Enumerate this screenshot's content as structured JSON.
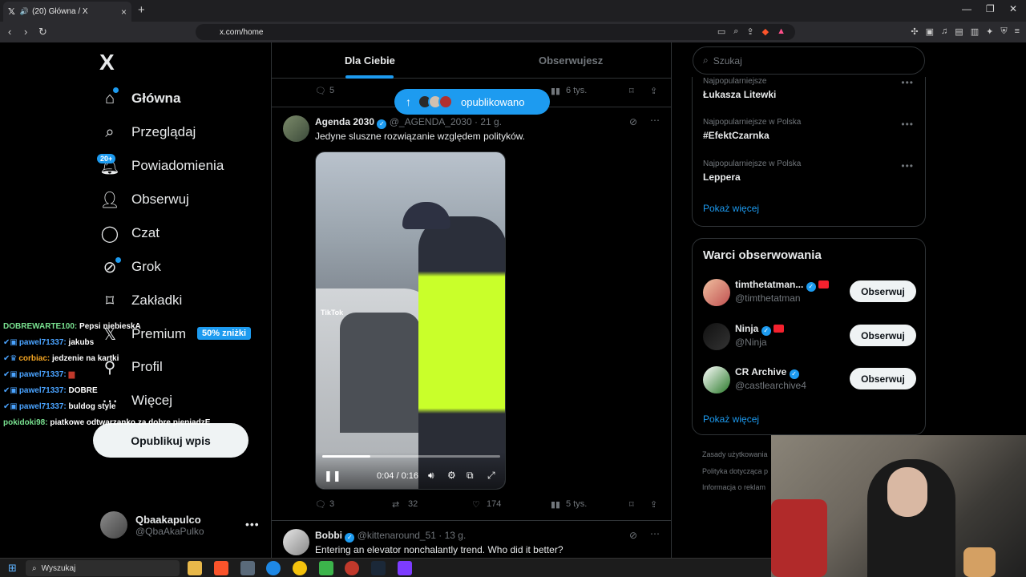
{
  "browser": {
    "tab_title": "(20) Główna / X",
    "url": "x.com/home"
  },
  "sidebar": {
    "logo": "X",
    "items": [
      {
        "label": "Główna"
      },
      {
        "label": "Przeglądaj"
      },
      {
        "label": "Powiadomienia",
        "badge": "20+"
      },
      {
        "label": "Obserwuj"
      },
      {
        "label": "Czat"
      },
      {
        "label": "Grok"
      },
      {
        "label": "Zakładki"
      },
      {
        "label": "Premium",
        "pill": "50% zniżki"
      },
      {
        "label": "Profil"
      },
      {
        "label": "Więcej"
      }
    ],
    "publish": "Opublikuj wpis",
    "profile": {
      "name": "Qbaakapulco",
      "handle": "@QbaAkaPulko"
    }
  },
  "chat": [
    {
      "user": "DOBREWARTE100:",
      "msg": "Pepsi niebieskA",
      "color": "green"
    },
    {
      "user": "pawel71337:",
      "msg": "jakubs",
      "color": "blue"
    },
    {
      "user": "corbiac:",
      "msg": "jedzenie na kartki",
      "color": "orange"
    },
    {
      "user": "pawel71337:",
      "msg": "",
      "color": "blue"
    },
    {
      "user": "pawel71337:",
      "msg": "DOBRE",
      "color": "blue"
    },
    {
      "user": "pawel71337:",
      "msg": "buldog style",
      "color": "blue"
    },
    {
      "user": "pokidoki98:",
      "msg": "piatkowe odtwarzanko za dobre pieniadzE",
      "color": "green"
    }
  ],
  "feed": {
    "tabs": [
      "Dla Ciebie",
      "Obserwujesz"
    ],
    "prev_post": {
      "replies": "5",
      "views": "6 tys."
    },
    "new_posts_pill": "opublikowano",
    "post": {
      "name": "Agenda 2030",
      "handle": "@_AGENDA_2030",
      "time": "· 21 g.",
      "text": "Jedyne sluszne rozwiązanie względem polityków.",
      "video_watermark": "TikTok",
      "video_time": "0:04 / 0:16",
      "video_progress": 0.27,
      "replies": "3",
      "reposts": "32",
      "likes": "174",
      "views": "5 tys."
    },
    "next_post": {
      "name": "Bobbi",
      "handle": "@kittenaround_51",
      "time": "· 13 g.",
      "text": "Entering an elevator nonchalantly trend. Who did it better?"
    }
  },
  "right": {
    "search_placeholder": "Szukaj",
    "trends": [
      {
        "category": "Najpopularniejsze",
        "name": "Łukasza Litewki"
      },
      {
        "category": "Najpopularniejsze w Polska",
        "name": "#EfektCzarnka"
      },
      {
        "category": "Najpopularniejsze w Polska",
        "name": "Leppera"
      }
    ],
    "show_more": "Pokaż więcej",
    "who_title": "Warci obserwowania",
    "accounts": [
      {
        "name": "timthetatman...",
        "handle": "@timthetatman"
      },
      {
        "name": "Ninja",
        "handle": "@Ninja"
      },
      {
        "name": "CR Archive",
        "handle": "@castlearchive4"
      }
    ],
    "follow_label": "Obserwuj",
    "footer": [
      "Zasady użytkowania",
      "Polityka dotycząca p",
      "Informacja o reklam"
    ]
  },
  "taskbar": {
    "search": "Wyszukaj"
  },
  "colors": {
    "accent": "#1d9bf0",
    "background": "#000000",
    "border": "#2f3336"
  }
}
